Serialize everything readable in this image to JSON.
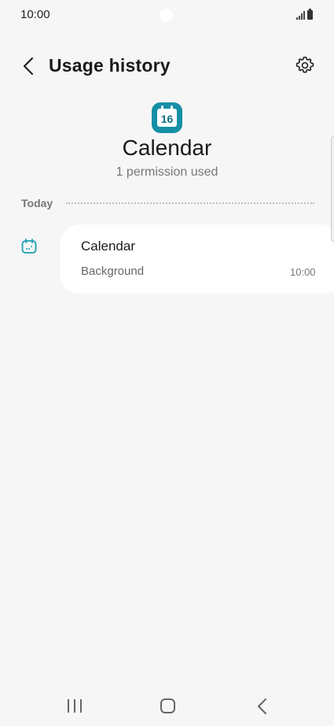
{
  "status_bar": {
    "time": "10:00",
    "icons": [
      "signal-icon",
      "battery-icon"
    ]
  },
  "header": {
    "title": "Usage history",
    "back_icon": "chevron-left-icon",
    "settings_icon": "gear-icon"
  },
  "app": {
    "icon_day": "16",
    "name": "Calendar",
    "subtitle": "1 permission used",
    "accent_color": "#1590a6"
  },
  "timeline": {
    "section_label": "Today",
    "items": [
      {
        "icon": "calendar-permission-icon",
        "title": "Calendar",
        "mode": "Background",
        "time": "10:00"
      }
    ]
  },
  "nav_bar": {
    "buttons": [
      "recent-apps",
      "home",
      "back"
    ]
  }
}
